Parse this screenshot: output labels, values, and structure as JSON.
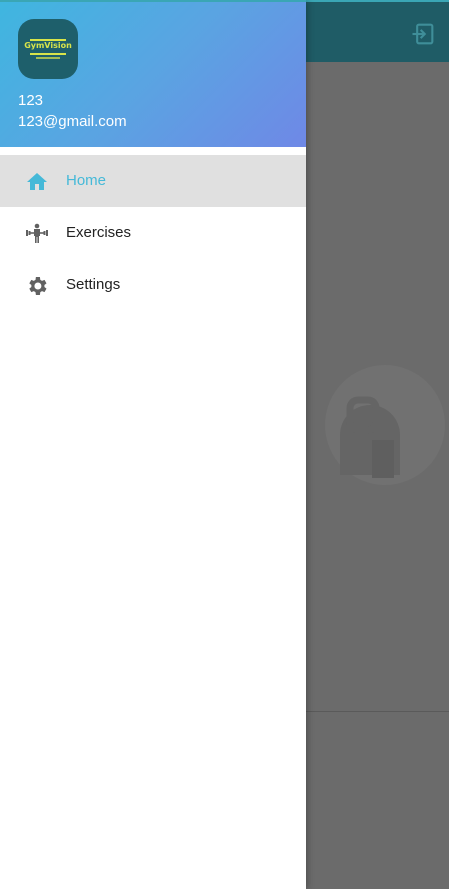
{
  "app": {
    "brand_color": "#1f5c66",
    "dim_overlay_color": "#6b6b6b",
    "logout_icon": "logout-icon"
  },
  "drawer": {
    "logo_text": "GymVision",
    "user": {
      "name": "123",
      "email": "123@gmail.com"
    },
    "menu": [
      {
        "label": "Home",
        "icon": "home-icon",
        "active": true
      },
      {
        "label": "Exercises",
        "icon": "weightlifter-icon",
        "active": false
      },
      {
        "label": "Settings",
        "icon": "gear-icon",
        "active": false
      }
    ],
    "active_color": "#45b9d8"
  }
}
